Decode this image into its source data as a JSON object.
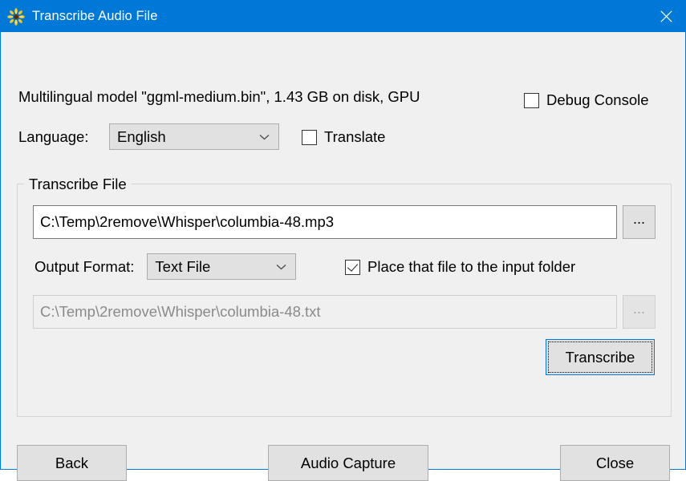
{
  "window": {
    "title": "Transcribe Audio File",
    "icon": "sunflower-icon",
    "accent_color": "#0078d7",
    "titlebar_bg": "#0078d7",
    "client_bg": "#f0f0f0",
    "close_label": "✕"
  },
  "header": {
    "model_info": "Multilingual model \"ggml-medium.bin\", 1.43 GB on disk, GPU",
    "debug_console": {
      "label": "Debug Console",
      "checked": false
    }
  },
  "language_row": {
    "label": "Language:",
    "selected": "English",
    "options": [
      "English"
    ],
    "translate": {
      "label": "Translate",
      "checked": false
    }
  },
  "transcribe_file": {
    "group_title": "Transcribe File",
    "input_path": {
      "value": "C:\\Temp\\2remove\\Whisper\\columbia-48.mp3",
      "browse_label": "...",
      "disabled": false
    },
    "output_format": {
      "label": "Output Format:",
      "selected": "Text File",
      "options": [
        "Text File"
      ]
    },
    "place_in_input_folder": {
      "label": "Place that file to the input folder",
      "checked": true
    },
    "output_path": {
      "value": "C:\\Temp\\2remove\\Whisper\\columbia-48.txt",
      "browse_label": "...",
      "disabled": true
    },
    "transcribe_button": {
      "label": "Transcribe",
      "focused": true
    }
  },
  "footer": {
    "back_label": "Back",
    "audio_capture_label": "Audio Capture",
    "close_label": "Close"
  }
}
